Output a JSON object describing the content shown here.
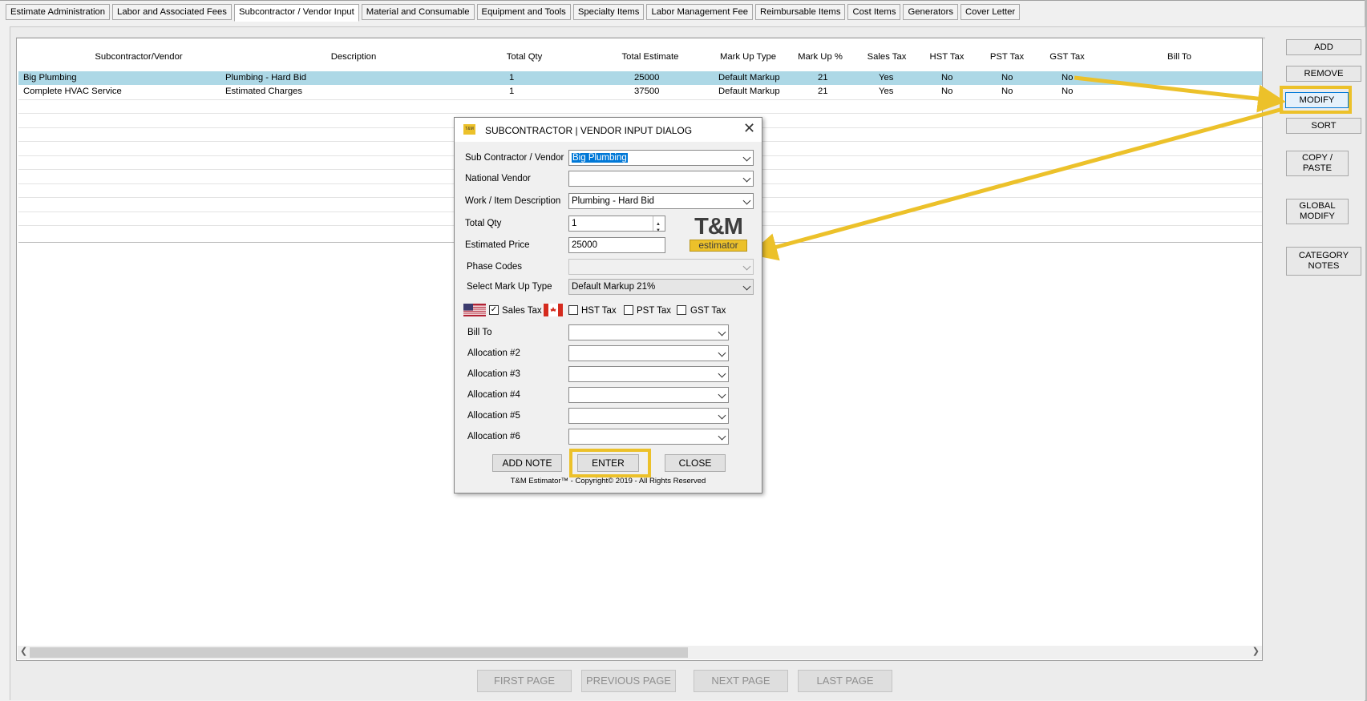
{
  "tabs": [
    {
      "label": "Estimate Administration"
    },
    {
      "label": "Labor and Associated Fees"
    },
    {
      "label": "Subcontractor / Vendor Input"
    },
    {
      "label": "Material and Consumable"
    },
    {
      "label": "Equipment and Tools"
    },
    {
      "label": "Specialty Items"
    },
    {
      "label": "Labor Management Fee"
    },
    {
      "label": "Reimbursable Items"
    },
    {
      "label": "Cost Items"
    },
    {
      "label": "Generators"
    },
    {
      "label": "Cover Letter"
    }
  ],
  "active_tab": "Subcontractor / Vendor Input",
  "grid": {
    "columns": [
      "Subcontractor/Vendor",
      "Description",
      "Total Qty",
      "Total Estimate",
      "Mark Up Type",
      "Mark Up %",
      "Sales Tax",
      "HST Tax",
      "PST Tax",
      "GST Tax",
      "Bill To"
    ],
    "rows": [
      {
        "vendor": "Big Plumbing",
        "description": "Plumbing - Hard Bid",
        "qty": "1",
        "estimate": "25000",
        "markup_type": "Default Markup",
        "markup_pct": "21",
        "sales_tax": "Yes",
        "hst": "No",
        "pst": "No",
        "gst": "No",
        "bill_to": ""
      },
      {
        "vendor": "Complete HVAC Service",
        "description": "Estimated Charges",
        "qty": "1",
        "estimate": "37500",
        "markup_type": "Default Markup",
        "markup_pct": "21",
        "sales_tax": "Yes",
        "hst": "No",
        "pst": "No",
        "gst": "No",
        "bill_to": ""
      }
    ],
    "selected_row": 0
  },
  "side_buttons": {
    "add": "ADD",
    "remove": "REMOVE",
    "modify": "MODIFY",
    "sort": "SORT",
    "copy_paste": "COPY / PASTE",
    "global_modify": "GLOBAL MODIFY",
    "category_notes": "CATEGORY NOTES"
  },
  "pager": {
    "first": "FIRST PAGE",
    "previous": "PREVIOUS PAGE",
    "next": "NEXT PAGE",
    "last": "LAST PAGE"
  },
  "dialog": {
    "title": "SUBCONTRACTOR | VENDOR INPUT DIALOG",
    "logo_small": "T&M",
    "fields": {
      "vendor_label": "Sub Contractor / Vendor",
      "vendor_value": "Big Plumbing",
      "national_label": "National Vendor",
      "national_value": "",
      "desc_label": "Work / Item Description",
      "desc_value": "Plumbing - Hard Bid",
      "qty_label": "Total Qty",
      "qty_value": "1",
      "price_label": "Estimated Price",
      "price_value": "25000",
      "phase_label": "Phase Codes",
      "phase_value": "",
      "markup_label": "Select Mark Up Type",
      "markup_value": "Default Markup 21%"
    },
    "taxes": {
      "sales": {
        "label": "Sales Tax",
        "checked": true
      },
      "hst": {
        "label": "HST Tax",
        "checked": false
      },
      "pst": {
        "label": "PST Tax",
        "checked": false
      },
      "gst": {
        "label": "GST Tax",
        "checked": false
      }
    },
    "allocations": [
      {
        "label": "Bill To",
        "value": ""
      },
      {
        "label": "Allocation #2",
        "value": ""
      },
      {
        "label": "Allocation #3",
        "value": ""
      },
      {
        "label": "Allocation #4",
        "value": ""
      },
      {
        "label": "Allocation #5",
        "value": ""
      },
      {
        "label": "Allocation #6",
        "value": ""
      }
    ],
    "buttons": {
      "add_note": "ADD NOTE",
      "enter": "ENTER",
      "close": "CLOSE"
    },
    "brand": {
      "big": "T&M",
      "small": "estimator"
    },
    "copyright": "T&M Estimator™ - Copyright© 2019 - All Rights Reserved"
  },
  "colors": {
    "highlight": "#ecc12a",
    "selected_row": "#add8e6",
    "selection": "#0078d7"
  }
}
